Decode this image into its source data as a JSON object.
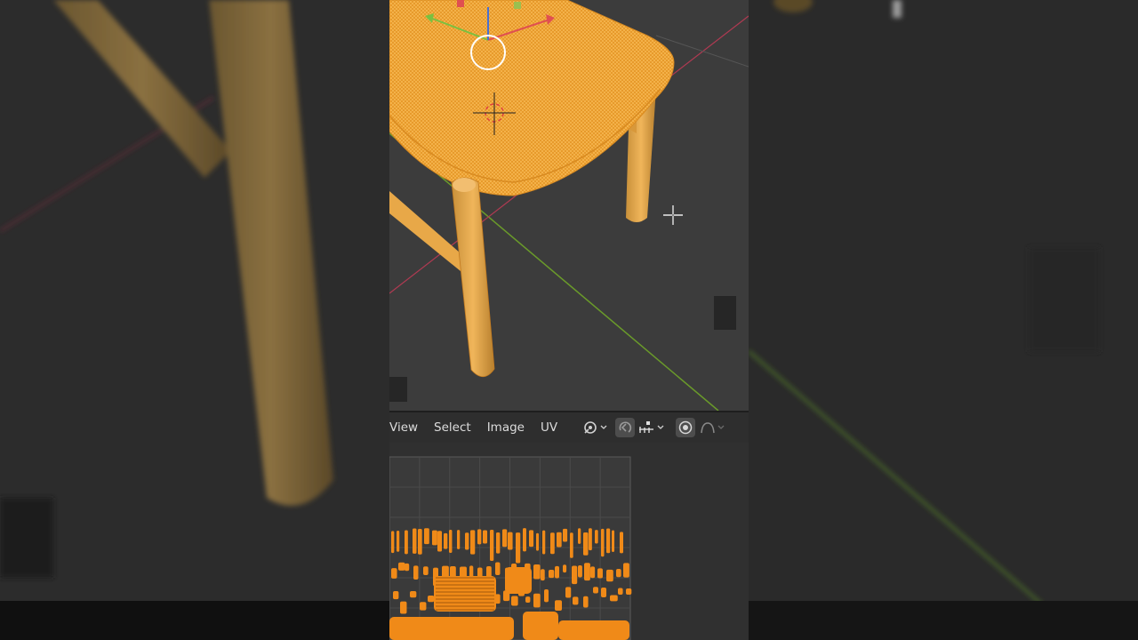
{
  "uv_editor": {
    "menu": {
      "view": "View",
      "select": "Select",
      "image": "Image",
      "uv": "UV"
    },
    "tools": {
      "pivot_icon": "pivot-point-icon",
      "sync_icon": "uv-sync-selection-icon",
      "snap_icon": "snap-icon",
      "proportional_icon": "proportional-editing-icon",
      "falloff_icon": "falloff-curve-icon"
    }
  },
  "viewport": {
    "object_color": "#f0a030",
    "background_color": "#3c3c3c",
    "axis_x_color": "#c0405a",
    "axis_y_color": "#7aa030",
    "cursor_icon": "3d-cursor-icon",
    "mouse_pointer_icon": "crosshair-pointer-icon",
    "gizmo_icon": "transform-gizmo-icon"
  },
  "uv_area": {
    "island_color": "#f08a18",
    "grid_color": "#4a4a4a"
  }
}
